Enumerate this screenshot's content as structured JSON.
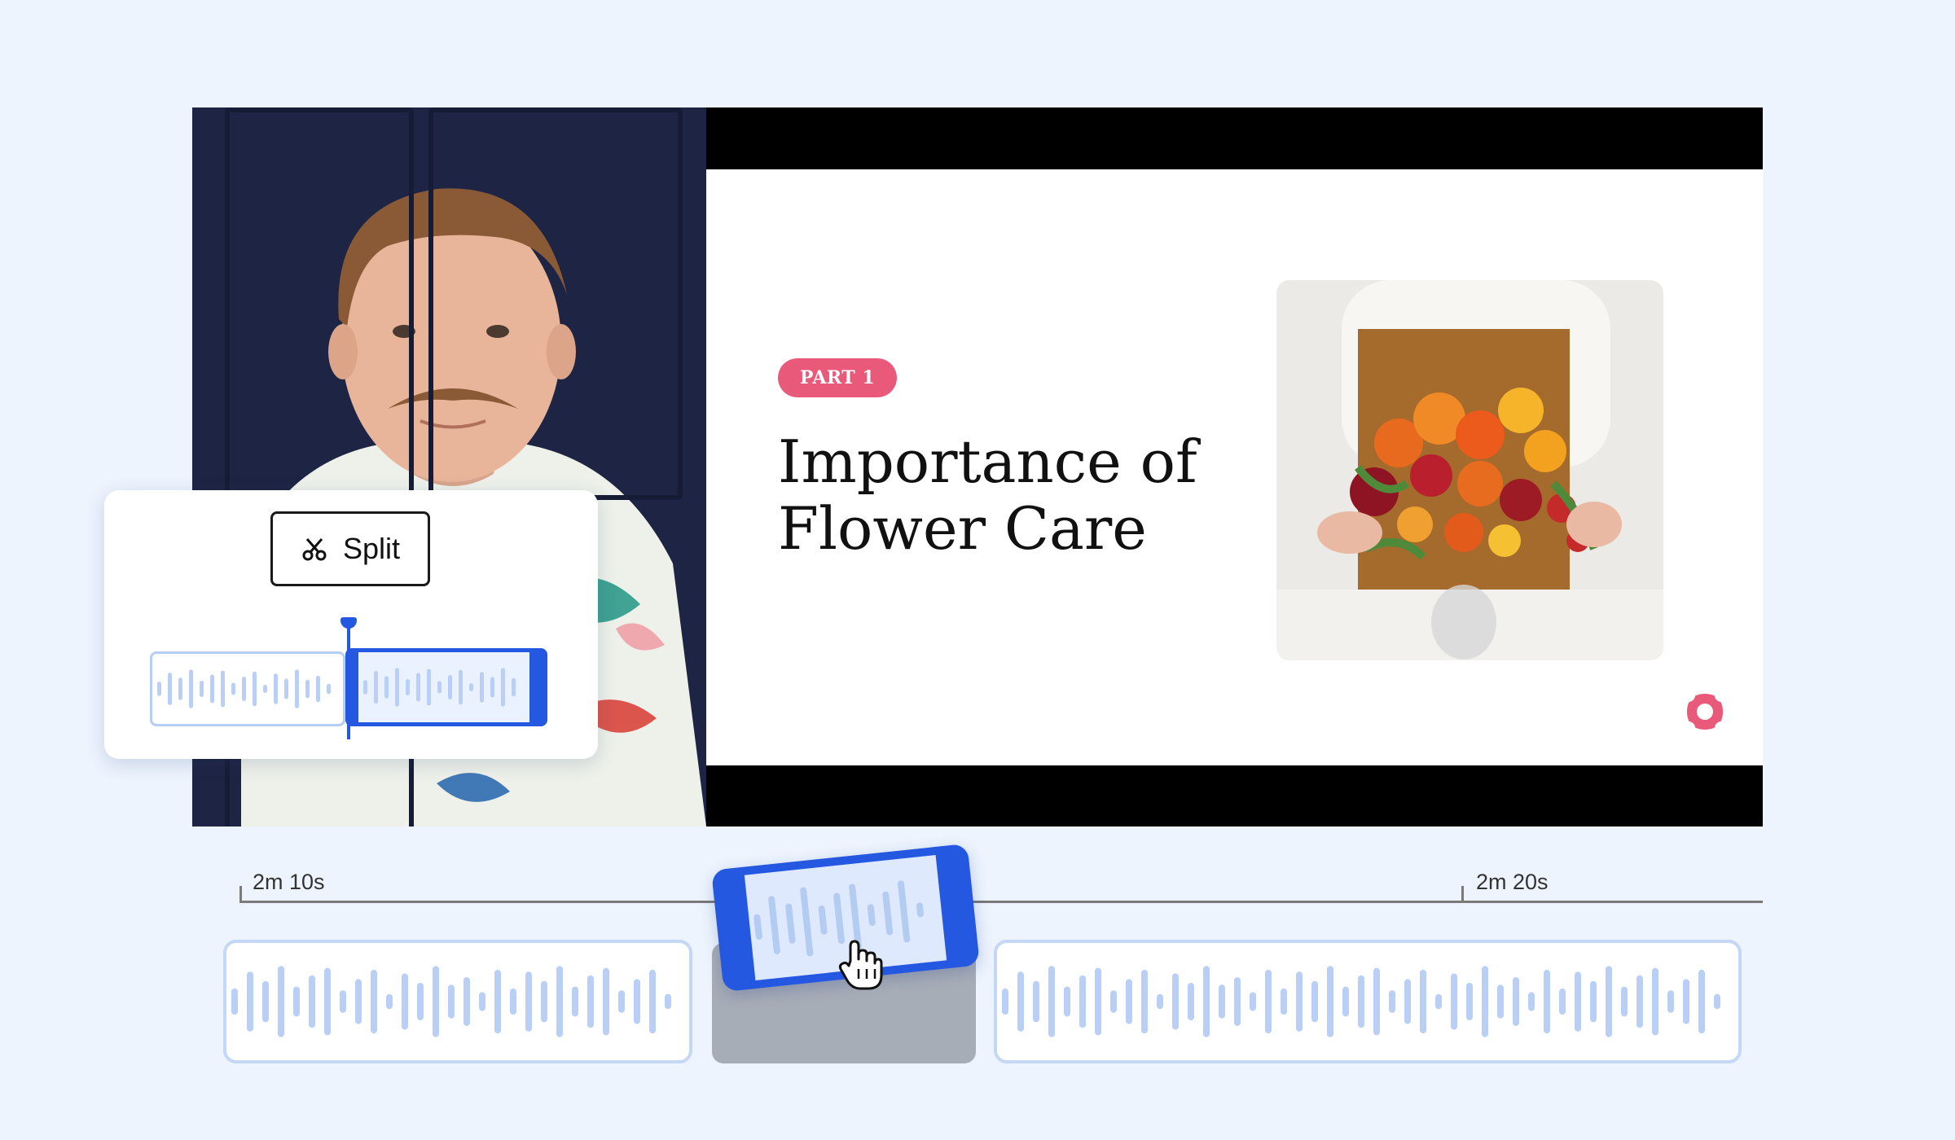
{
  "slide": {
    "badge": "PART 1",
    "title_line1": "Importance of",
    "title_line2": "Flower Care"
  },
  "split_panel": {
    "button_label": "Split",
    "button_icon": "scissors-icon"
  },
  "timeline": {
    "ticks": [
      {
        "label": "2m 10s"
      },
      {
        "label": "2m 20s"
      }
    ]
  },
  "colors": {
    "accent": "#2458e0",
    "badge": "#e8597a",
    "background": "#edf4fe",
    "waveform": "#b9cff5"
  }
}
